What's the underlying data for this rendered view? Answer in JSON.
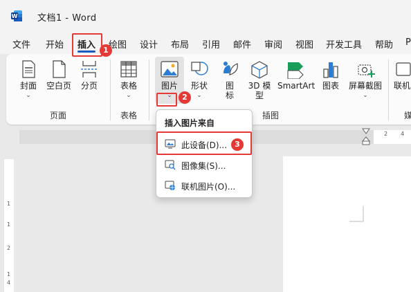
{
  "titlebar": {
    "title": "文档1  -  Word"
  },
  "tabs": [
    "文件",
    "开始",
    "插入",
    "绘图",
    "设计",
    "布局",
    "引用",
    "邮件",
    "审阅",
    "视图",
    "开发工具",
    "帮助",
    "P"
  ],
  "active_tab": "插入",
  "ribbon": {
    "cover_page": "封面",
    "blank_page": "空白页",
    "page_break": "分页",
    "table": "表格",
    "pictures": "图片",
    "shapes": "形状",
    "icons_1": "图",
    "icons_2": "标",
    "models_1": "3D 模",
    "models_2": "型",
    "smartart": "SmartArt",
    "chart": "图表",
    "screenshot": "屏幕截图",
    "online": "联机",
    "group_pages": "页面",
    "group_tables": "表格",
    "group_illustrations": "插图",
    "group_media": "媒"
  },
  "dropdown": {
    "title": "插入图片来自",
    "items": [
      "此设备(D)...",
      "图像集(S)...",
      "联机图片(O)..."
    ]
  },
  "ruler": {
    "top_ticks": [
      "2",
      "4",
      "6"
    ],
    "left_ticks": [
      "1",
      "1",
      "2",
      "1",
      "4"
    ]
  },
  "badges": [
    "1",
    "2",
    "3"
  ],
  "colors": {
    "word_blue": "#185abd",
    "callout_red": "#e53935"
  }
}
